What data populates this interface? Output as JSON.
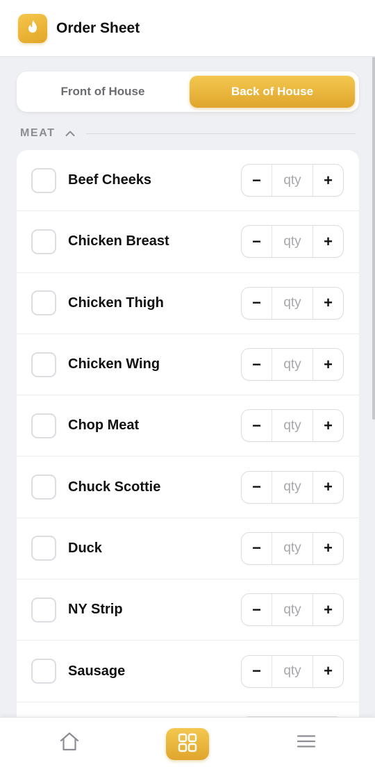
{
  "header": {
    "title": "Order Sheet",
    "logo_icon": "flame-icon"
  },
  "tabs": [
    {
      "label": "Front of House",
      "active": false
    },
    {
      "label": "Back of House",
      "active": true
    }
  ],
  "section": {
    "title": "MEAT",
    "expanded": true
  },
  "items": [
    {
      "name": "Beef Cheeks",
      "checked": false,
      "qty": ""
    },
    {
      "name": "Chicken Breast",
      "checked": false,
      "qty": ""
    },
    {
      "name": "Chicken Thigh",
      "checked": false,
      "qty": ""
    },
    {
      "name": "Chicken Wing",
      "checked": false,
      "qty": ""
    },
    {
      "name": "Chop Meat",
      "checked": false,
      "qty": ""
    },
    {
      "name": "Chuck Scottie",
      "checked": false,
      "qty": ""
    },
    {
      "name": "Duck",
      "checked": false,
      "qty": ""
    },
    {
      "name": "NY Strip",
      "checked": false,
      "qty": ""
    },
    {
      "name": "Sausage",
      "checked": false,
      "qty": ""
    },
    {
      "name": "",
      "checked": false,
      "qty": ""
    }
  ],
  "stepper": {
    "minus_label": "−",
    "plus_label": "+",
    "qty_placeholder": "qty"
  },
  "bottom_nav": [
    {
      "icon": "home-icon",
      "active": false
    },
    {
      "icon": "grid-icon",
      "active": true
    },
    {
      "icon": "menu-icon",
      "active": false
    }
  ],
  "colors": {
    "accent": "#e8b33a",
    "accent_light": "#f3c850",
    "background": "#eff0f4"
  }
}
